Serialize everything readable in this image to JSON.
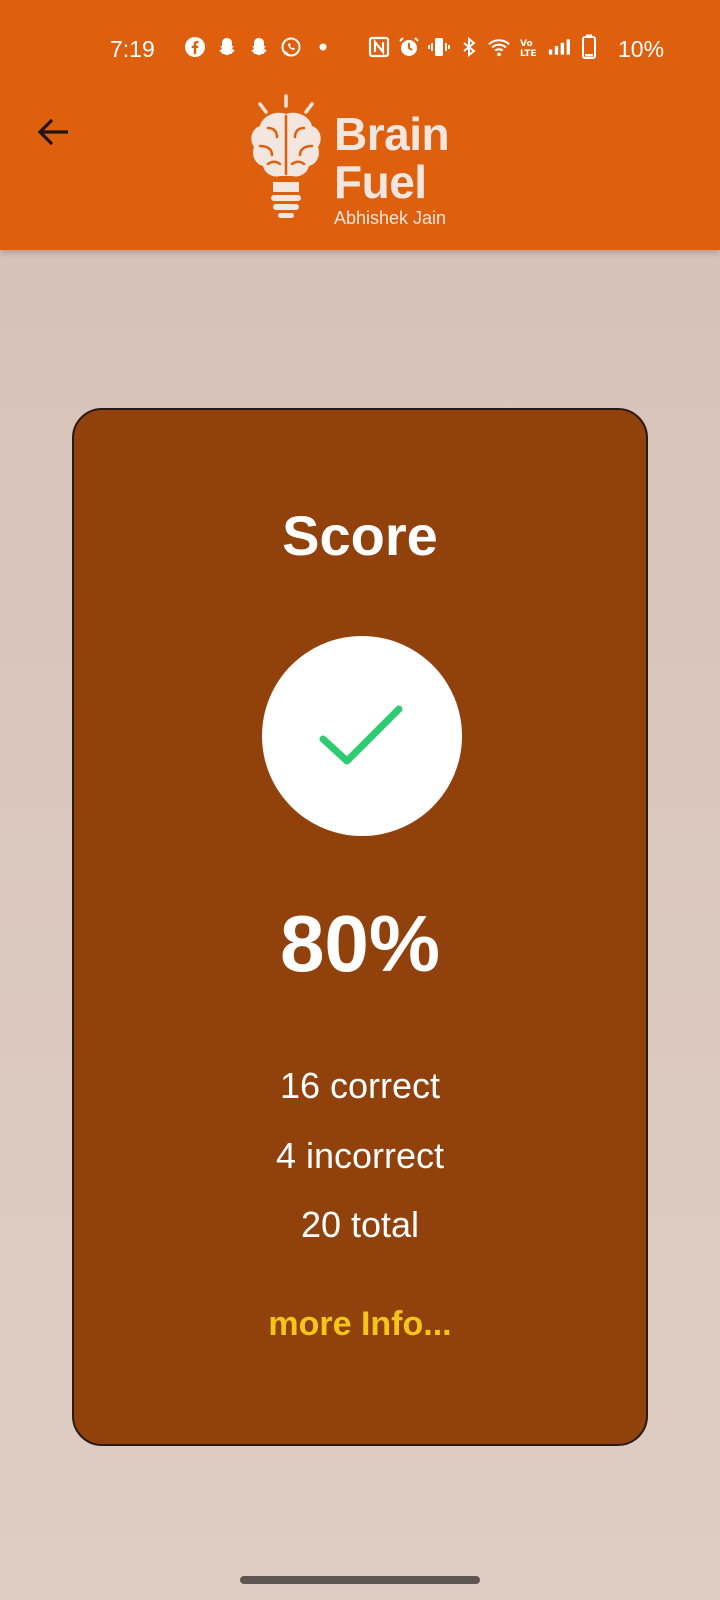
{
  "status_bar": {
    "time": "7:19",
    "battery": "10%",
    "left_icons": [
      "facebook-icon",
      "snapchat-icon",
      "snapchat-icon",
      "whatsapp-icon",
      "dot-icon"
    ],
    "right_icons": [
      "nfc-icon",
      "alarm-icon",
      "vibrate-icon",
      "bluetooth-icon",
      "wifi-icon",
      "volte-icon",
      "signal-icon",
      "battery-icon"
    ]
  },
  "header": {
    "logo_title": "Brain\nFuel",
    "logo_subtitle": "Abhishek Jain",
    "colors": {
      "bar": "#de600e",
      "logo": "#f2e6de"
    }
  },
  "score_card": {
    "title": "Score",
    "percent": "80%",
    "correct": "16 correct",
    "incorrect": "4 incorrect",
    "total": "20 total",
    "more_info": "more Info...",
    "colors": {
      "card": "#91420c",
      "check": "#2ecc71",
      "link": "#f5c518"
    }
  }
}
